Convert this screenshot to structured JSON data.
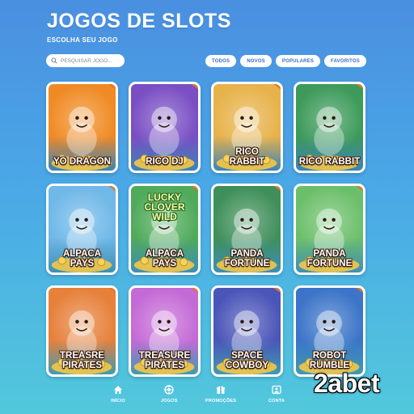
{
  "header": {
    "title": "JOGOS DE SLOTS",
    "subtitle": "ESCOLHA SEU JOGO"
  },
  "search": {
    "icon": "search-icon",
    "placeholder": "PESQUISAR JOGO..."
  },
  "filters": [
    {
      "label": "TODOS"
    },
    {
      "label": "NOVOS"
    },
    {
      "label": "POPULARES"
    },
    {
      "label": "FAVORITOS"
    }
  ],
  "games": [
    {
      "name": "YO DRAGON",
      "badge": "",
      "bg": "#f08a24"
    },
    {
      "name": "RICO DJ",
      "badge": "",
      "bg": "#7a4ec4"
    },
    {
      "name": "RICO\nRABBIT",
      "badge": "",
      "bg": "#e7b24a"
    },
    {
      "name": "RICO RABBIT",
      "badge": "",
      "bg": "#3c9a5a"
    },
    {
      "name": "ALPACA\nPAYS",
      "badge": "",
      "bg": "#6fb8e8"
    },
    {
      "name": "ALPACA\nPAYS",
      "top_title": "LUCKY\nCLOVER\nWILD",
      "badge": "",
      "bg": "#4faa5a"
    },
    {
      "name": "PANDA\nFORTUNE",
      "badge": "",
      "bg": "#3f8f5a"
    },
    {
      "name": "PANDA\nFORTUNE",
      "badge": "",
      "bg": "#6cbf6a"
    },
    {
      "name": "TREASRE\nPIRATES",
      "badge": "",
      "bg": "#e6803a"
    },
    {
      "name": "TREASURE\nPIRATES",
      "badge": "",
      "bg": "#c46ad6"
    },
    {
      "name": "SPACE\nCOWBOY",
      "badge": "",
      "bg": "#4a55b8"
    },
    {
      "name": "ROBOT\nRUMBLE",
      "badge": "",
      "bg": "#3b74c8"
    }
  ],
  "nav": [
    {
      "label": "INÍCIO",
      "icon": "home-icon"
    },
    {
      "label": "JOGOS",
      "icon": "games-icon"
    },
    {
      "label": "PROMOÇÕES",
      "icon": "gift-icon"
    },
    {
      "label": "CONTA",
      "icon": "account-icon"
    }
  ],
  "watermark": "2abet"
}
